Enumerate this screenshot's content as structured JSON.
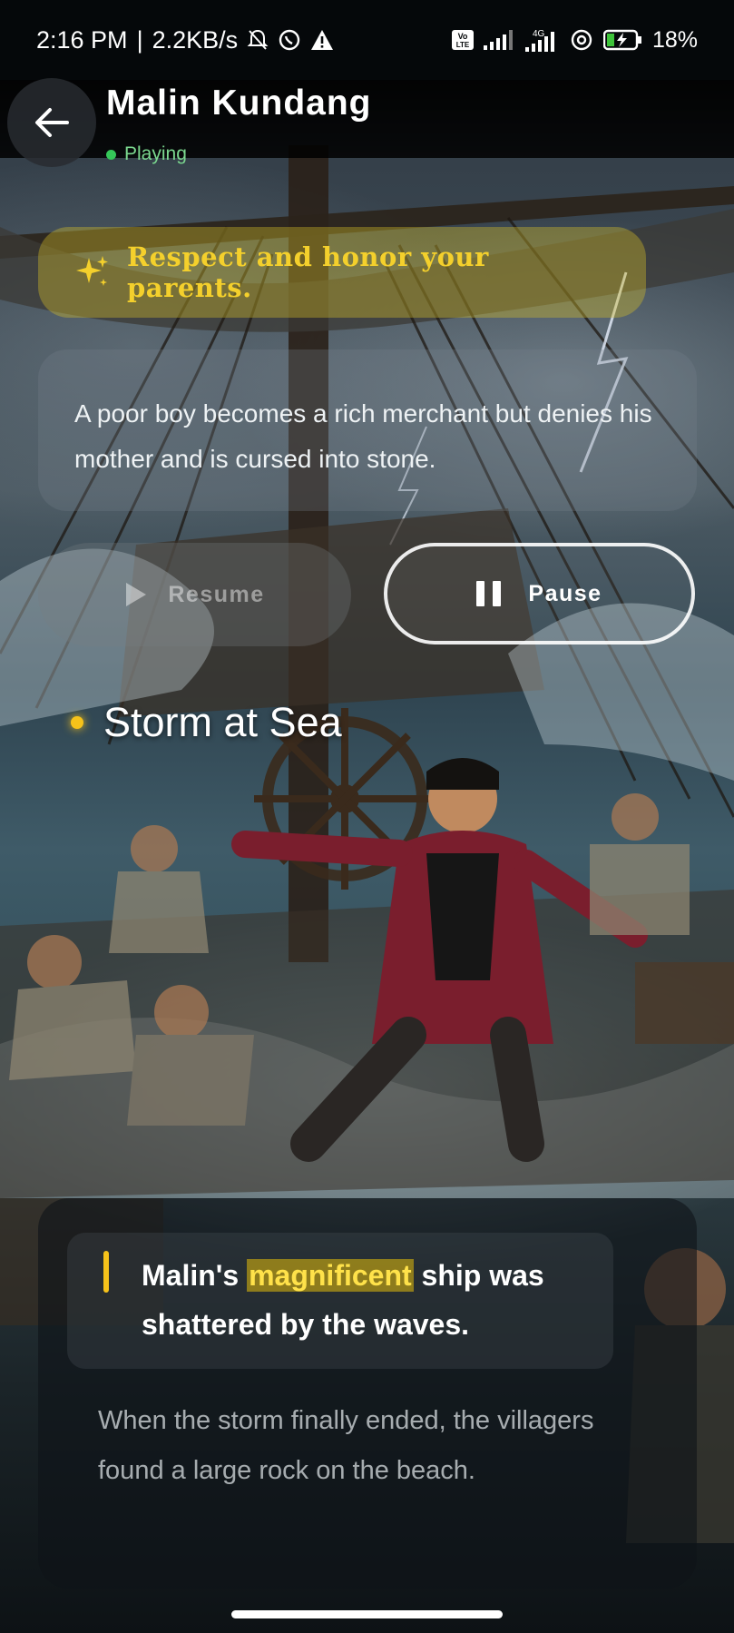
{
  "status_bar": {
    "time": "2:16 PM",
    "network_speed": "2.2KB/s",
    "separator": "|",
    "battery_percent": "18%",
    "network_label": "4G",
    "volte_label": "Vo LTE",
    "icons": [
      "mute-bell-icon",
      "whatsapp-icon",
      "warning-icon",
      "volte-icon",
      "signal-icon",
      "signal-4g-icon",
      "hotspot-icon",
      "battery-charging-icon"
    ]
  },
  "header": {
    "title": "Malin Kundang",
    "status": "Playing",
    "status_color": "#35c759"
  },
  "moral": {
    "text": "Respect and honor your parents.",
    "icon": "sparkle-icon",
    "color": "#f4d02c"
  },
  "summary": {
    "text": "A poor boy becomes a rich merchant but denies his mother and is cursed into stone."
  },
  "controls": {
    "resume_label": "Resume",
    "pause_label": "Pause"
  },
  "scene": {
    "title": "Storm at Sea"
  },
  "narration": {
    "current_before": "Malin's ",
    "current_highlight": "magnificent",
    "current_after": " ship was shattered by the waves.",
    "next": "When the storm finally ended, the villagers found a large rock on the beach.",
    "highlight_color": "#f6c21a"
  }
}
